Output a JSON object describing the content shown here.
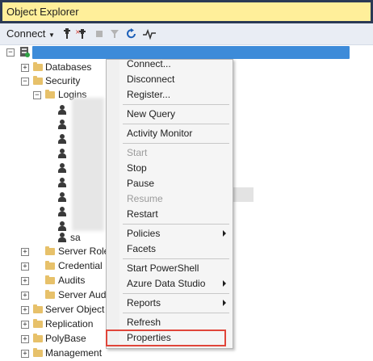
{
  "window": {
    "title": "Object Explorer"
  },
  "toolbar": {
    "connect_label": "Connect"
  },
  "tree": {
    "items": [
      {
        "label": "Databases"
      },
      {
        "label": "Security"
      },
      {
        "label": "Logins"
      },
      {
        "label": "sa"
      },
      {
        "label": "Server Role"
      },
      {
        "label": "Credential"
      },
      {
        "label": "Audits"
      },
      {
        "label": "Server Aud"
      },
      {
        "label": "Server Object"
      },
      {
        "label": "Replication"
      },
      {
        "label": "PolyBase"
      },
      {
        "label": "Management"
      }
    ]
  },
  "context_menu": {
    "items": [
      {
        "label": "Connect..."
      },
      {
        "label": "Disconnect"
      },
      {
        "label": "Register..."
      },
      {
        "label": "New Query"
      },
      {
        "label": "Activity Monitor"
      },
      {
        "label": "Start"
      },
      {
        "label": "Stop"
      },
      {
        "label": "Pause"
      },
      {
        "label": "Resume"
      },
      {
        "label": "Restart"
      },
      {
        "label": "Policies"
      },
      {
        "label": "Facets"
      },
      {
        "label": "Start PowerShell"
      },
      {
        "label": "Azure Data Studio"
      },
      {
        "label": "Reports"
      },
      {
        "label": "Refresh"
      },
      {
        "label": "Properties"
      }
    ]
  },
  "colors": {
    "title_bg": "#ffef9a",
    "selection": "#3d8bd9",
    "highlight_border": "#e0453a"
  },
  "icons": [
    "connect-icon",
    "disconnect-icon",
    "stop-icon",
    "filter-icon",
    "refresh-icon",
    "activity-monitor-icon",
    "server-icon",
    "folder-icon",
    "user-icon"
  ]
}
